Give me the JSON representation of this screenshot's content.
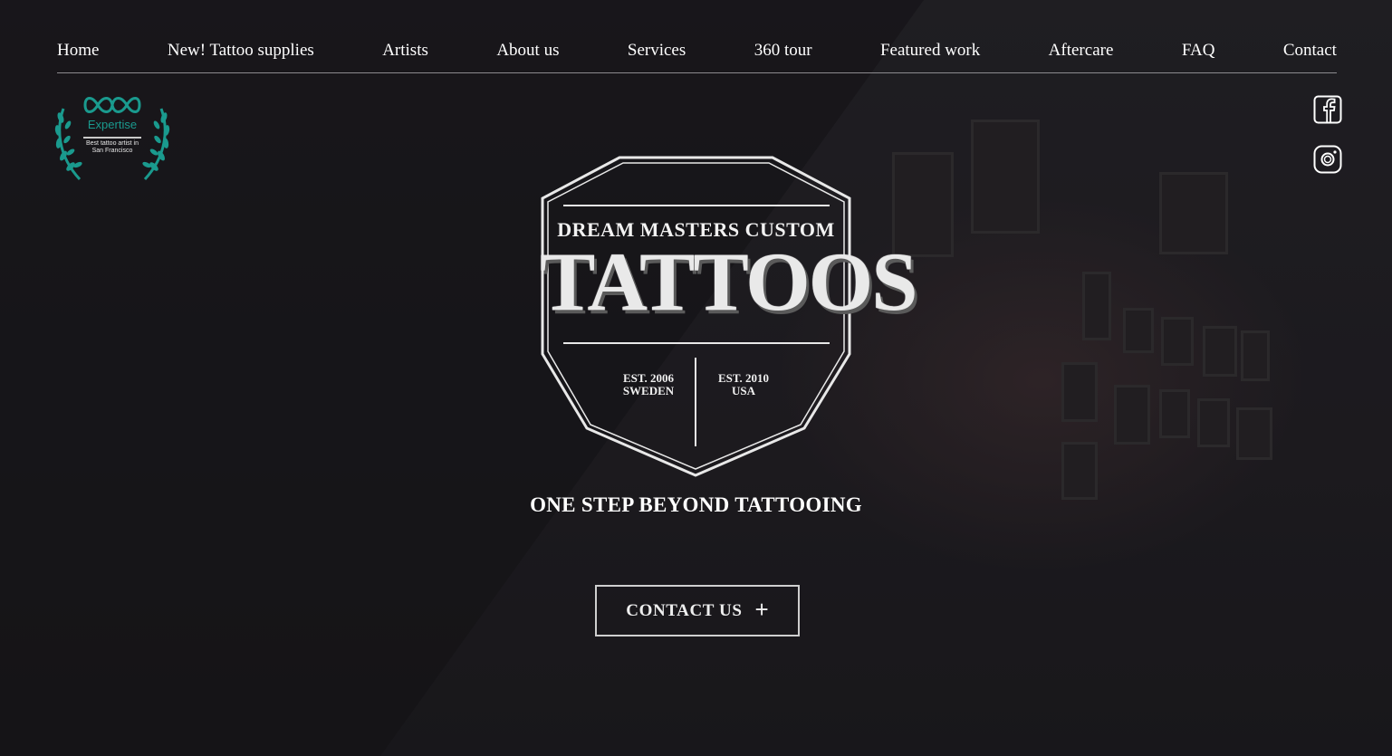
{
  "nav": {
    "items": [
      {
        "label": "Home"
      },
      {
        "label": "New! Tattoo supplies"
      },
      {
        "label": "Artists"
      },
      {
        "label": "About us"
      },
      {
        "label": "Services"
      },
      {
        "label": "360 tour"
      },
      {
        "label": "Featured work"
      },
      {
        "label": "Aftercare"
      },
      {
        "label": "FAQ"
      },
      {
        "label": "Contact"
      }
    ]
  },
  "badge": {
    "brand": "Expertise",
    "caption": "Best tattoo artist in San Francisco",
    "accent_color": "#1a9a8e"
  },
  "social": {
    "icons": [
      "facebook-icon",
      "instagram-icon"
    ]
  },
  "logo": {
    "line1": "DREAM MASTERS CUSTOM",
    "line2": "TATTOOS",
    "est_left_1": "EST. 2006",
    "est_left_2": "SWEDEN",
    "est_right_1": "EST. 2010",
    "est_right_2": "USA"
  },
  "hero": {
    "tagline": "ONE STEP BEYOND TATTOOING",
    "cta_label": "CONTACT US",
    "cta_icon": "+"
  },
  "colors": {
    "background": "#1e1c20",
    "text": "#ffffff"
  }
}
